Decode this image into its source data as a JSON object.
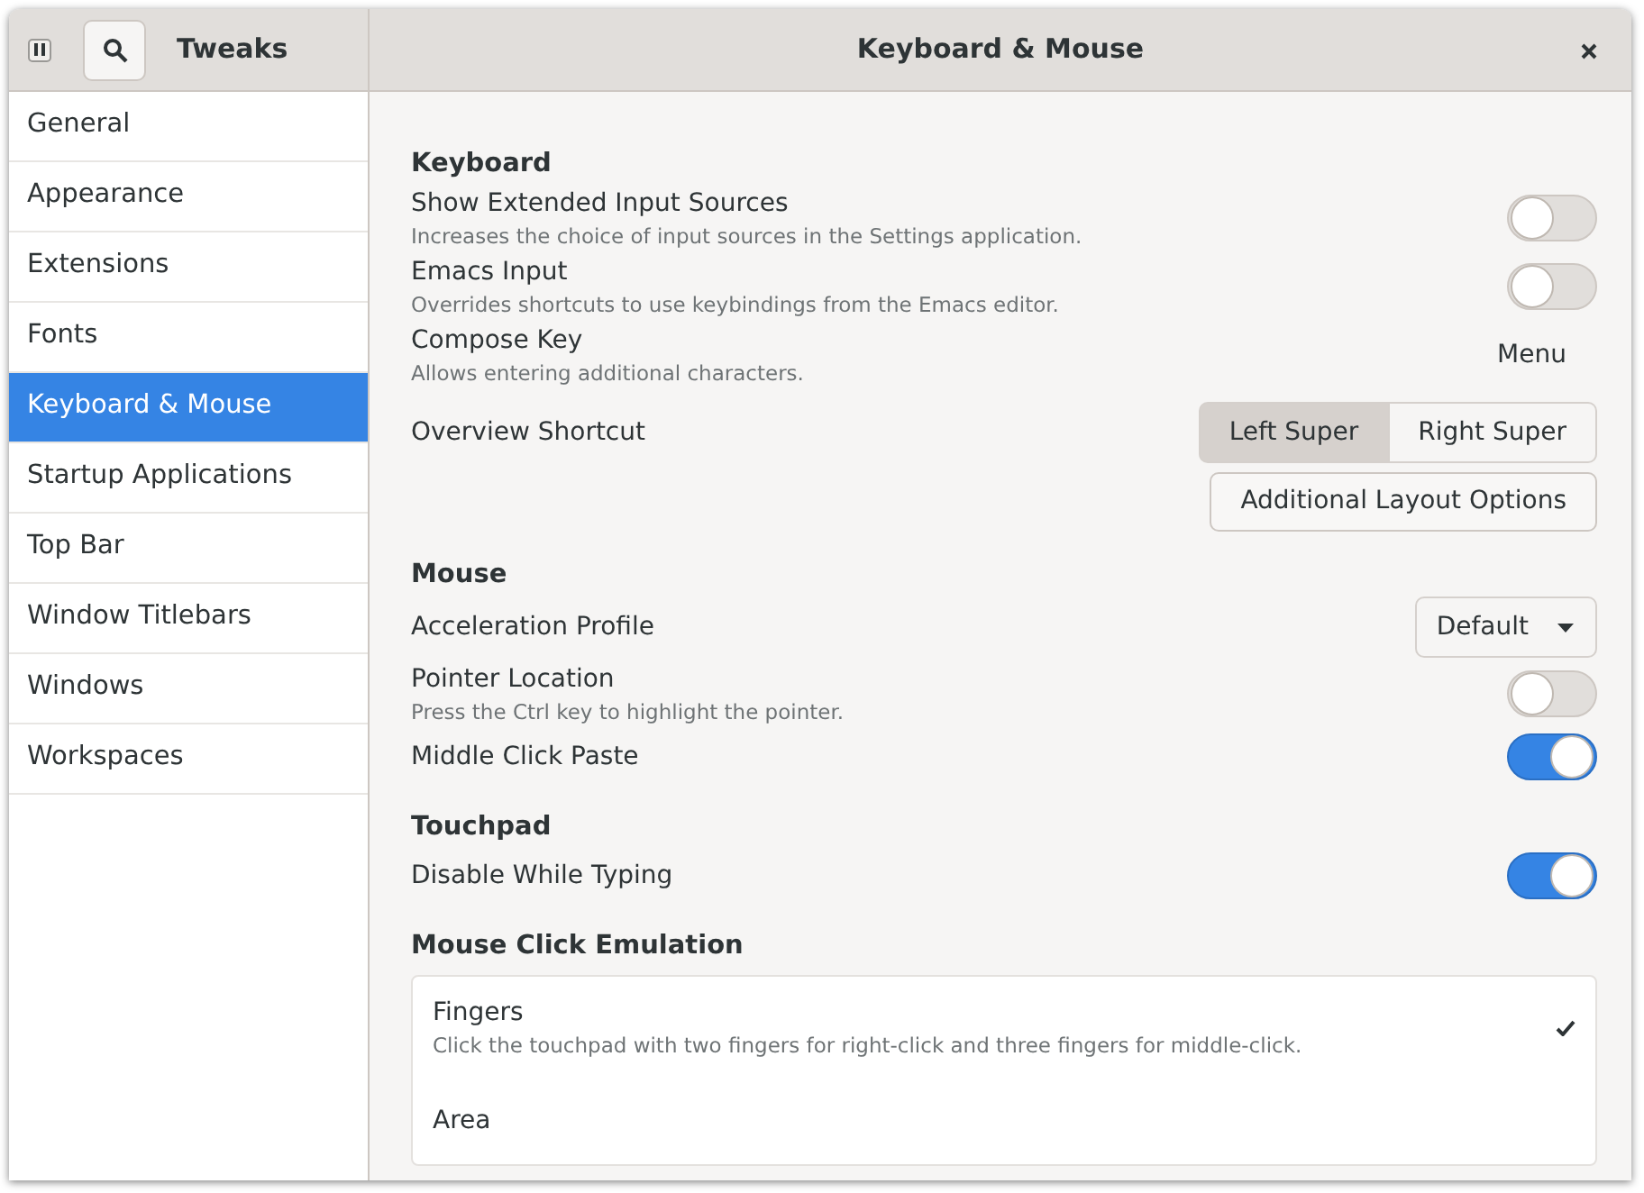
{
  "header": {
    "app_title": "Tweaks",
    "page_title": "Keyboard & Mouse"
  },
  "sidebar": {
    "items": [
      {
        "label": "General",
        "selected": false
      },
      {
        "label": "Appearance",
        "selected": false
      },
      {
        "label": "Extensions",
        "selected": false
      },
      {
        "label": "Fonts",
        "selected": false
      },
      {
        "label": "Keyboard & Mouse",
        "selected": true
      },
      {
        "label": "Startup Applications",
        "selected": false
      },
      {
        "label": "Top Bar",
        "selected": false
      },
      {
        "label": "Window Titlebars",
        "selected": false
      },
      {
        "label": "Windows",
        "selected": false
      },
      {
        "label": "Workspaces",
        "selected": false
      }
    ]
  },
  "sections": [
    {
      "title": "Keyboard",
      "rows": [
        {
          "kind": "switch",
          "label": "Show Extended Input Sources",
          "description": "Increases the choice of input sources in the Settings application.",
          "on": false
        },
        {
          "kind": "switch",
          "label": "Emacs Input",
          "description": "Overrides shortcuts to use keybindings from the Emacs editor.",
          "on": false
        },
        {
          "kind": "value",
          "label": "Compose Key",
          "description": "Allows entering additional characters.",
          "value": "Menu"
        },
        {
          "kind": "toggle",
          "label": "Overview Shortcut",
          "options": [
            {
              "label": "Left Super",
              "selected": true
            },
            {
              "label": "Right Super",
              "selected": false
            }
          ]
        },
        {
          "kind": "button",
          "label": "Additional Layout Options"
        }
      ]
    },
    {
      "title": "Mouse",
      "rows": [
        {
          "kind": "dropdown",
          "label": "Acceleration Profile",
          "value": "Default"
        },
        {
          "kind": "switch",
          "label": "Pointer Location",
          "description": "Press the Ctrl key to highlight the pointer.",
          "on": false
        },
        {
          "kind": "switch",
          "label": "Middle Click Paste",
          "on": true
        }
      ]
    },
    {
      "title": "Touchpad",
      "rows": [
        {
          "kind": "switch",
          "label": "Disable While Typing",
          "on": true
        }
      ]
    },
    {
      "title": "Mouse Click Emulation",
      "rows": [
        {
          "kind": "list",
          "items": [
            {
              "label": "Fingers",
              "description": "Click the touchpad with two fingers for right-click and three fingers for middle-click.",
              "selected": true
            },
            {
              "label": "Area",
              "selected": false
            }
          ]
        }
      ]
    }
  ]
}
